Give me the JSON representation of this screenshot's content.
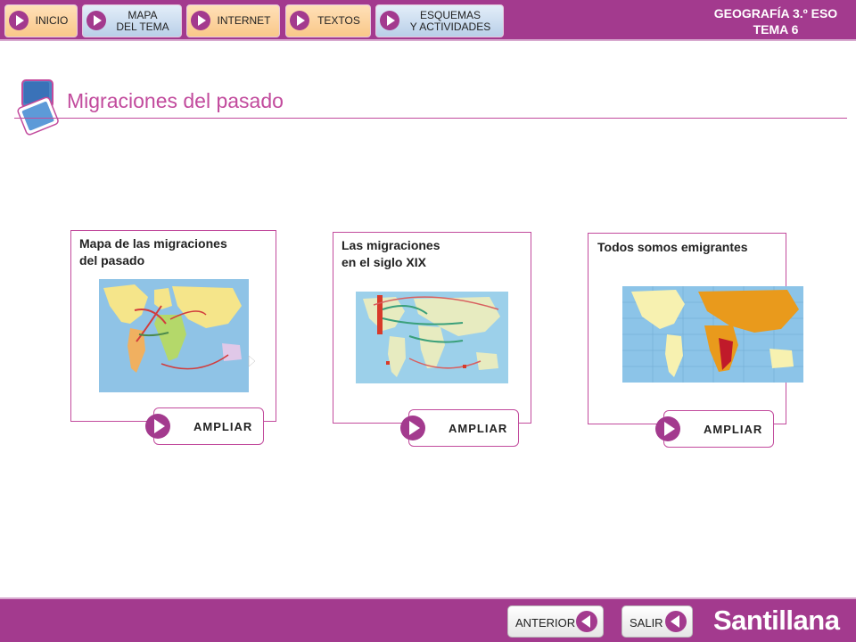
{
  "header": {
    "nav": [
      {
        "label": "INICIO",
        "style": "orange"
      },
      {
        "label": "MAPA\nDEL TEMA",
        "style": "blue"
      },
      {
        "label": "INTERNET",
        "style": "orange"
      },
      {
        "label": "TEXTOS",
        "style": "orange"
      },
      {
        "label": "ESQUEMAS\nY ACTIVIDADES",
        "style": "blue"
      }
    ],
    "subject_line1": "GEOGRAFÍA 3.º ESO",
    "subject_line2": "TEMA 6"
  },
  "page": {
    "title": "Migraciones del pasado"
  },
  "cards": [
    {
      "title": "Mapa de las migraciones\ndel pasado",
      "button": "AMPLIAR"
    },
    {
      "title": "Las migraciones\nen el siglo XIX",
      "button": "AMPLIAR"
    },
    {
      "title": "Todos somos emigrantes",
      "button": "AMPLIAR"
    }
  ],
  "footer": {
    "prev_label": "ANTERIOR",
    "exit_label": "SALIR",
    "brand": "Santillana"
  },
  "colors": {
    "brand": "#a33a8e",
    "accent": "#c24b9d",
    "nav_orange": "#f9c889",
    "nav_blue": "#b9cfe8"
  },
  "icons": [
    "play-icon",
    "back-icon",
    "title-squares-icon",
    "world-map-icon"
  ]
}
